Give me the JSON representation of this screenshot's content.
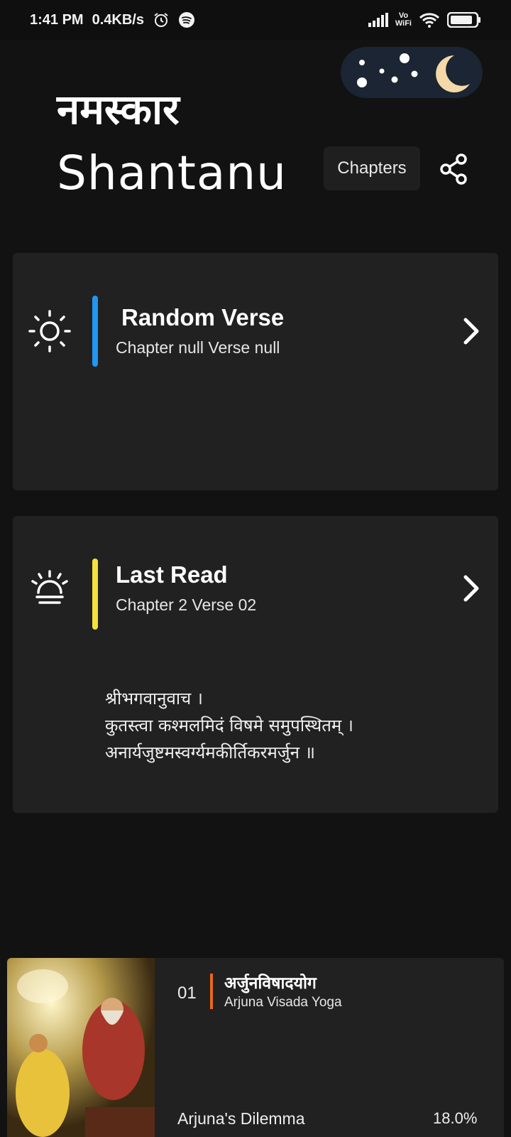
{
  "status_bar": {
    "time": "1:41 PM",
    "speed": "0.4KB/s",
    "icons": [
      "alarm-icon",
      "spotify-icon",
      "signal-icon",
      "vowifi-icon",
      "wifi-icon",
      "battery-icon"
    ],
    "vowifi_top": "Vo",
    "vowifi_bottom": "WiFi"
  },
  "header": {
    "greeting": "नमस्कार",
    "username": "Shantanu",
    "chapters_label": "Chapters",
    "theme_toggle": "night-mode-toggle"
  },
  "random_verse": {
    "title": "Random Verse",
    "subtitle": "Chapter null Verse null",
    "accent": "#2196f3"
  },
  "last_read": {
    "title": "Last Read",
    "subtitle": "Chapter 2 Verse 02",
    "accent": "#f5e13b",
    "verse_text": "श्रीभगवानुवाच ।\nकुतस्त्वा कश्मलमिदं विषमे समुपस्थितम् ।\nअनार्यजुष्टमस्वर्ग्यमकीर्तिकरमर्जुन ॥"
  },
  "chapter": {
    "number": "01",
    "name": "अर्जुनविषादयोग",
    "transliteration": "Arjuna Visada Yoga",
    "meaning": "Arjuna's Dilemma",
    "progress": "18.0%",
    "accent": "#e8671c"
  }
}
